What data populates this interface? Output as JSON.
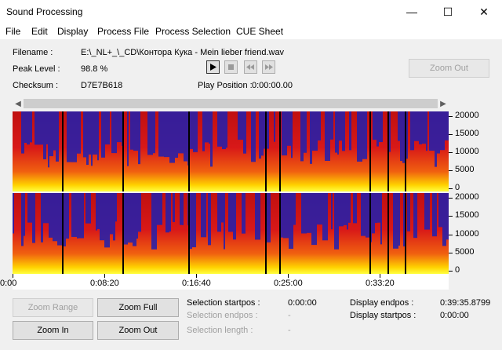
{
  "window": {
    "title": "Sound Processing",
    "min": "—",
    "max": "☐",
    "close": "✕"
  },
  "menu": [
    "File",
    "Edit",
    "Display",
    "Process File",
    "Process Selection",
    "CUE Sheet"
  ],
  "info": {
    "filename_label": "Filename :",
    "filename": "E:\\_NL+_\\_CD\\Контора Кука - Mein lieber friend.wav",
    "peak_label": "Peak Level :",
    "peak": "98.8 %",
    "checksum_label": "Checksum :",
    "checksum": "D7E7B618",
    "play_pos_label": "Play Position :",
    "play_pos": "0:00:00.00"
  },
  "buttons": {
    "zoom_out_top": "Zoom Out",
    "zoom_range": "Zoom Range",
    "zoom_full": "Zoom Full",
    "zoom_in": "Zoom In",
    "zoom_out": "Zoom Out"
  },
  "freq_ticks": [
    "20000",
    "15000",
    "10000",
    "5000",
    "0"
  ],
  "time_ticks": [
    "0:00",
    "0:08:20",
    "0:16:40",
    "0:25:00",
    "0:33:20"
  ],
  "selection": {
    "start_label": "Selection startpos :",
    "start": "0:00:00",
    "end_label": "Selection endpos :",
    "end": "-",
    "length_label": "Selection length :",
    "length": "-"
  },
  "display": {
    "end_label": "Display endpos :",
    "end": "0:39:35.8799",
    "start_label": "Display startpos :",
    "start": "0:00:00"
  },
  "colors": {
    "low": "#1a1aa8",
    "mid": "#d81818",
    "high": "#ffd200",
    "peak": "#ffff40"
  }
}
